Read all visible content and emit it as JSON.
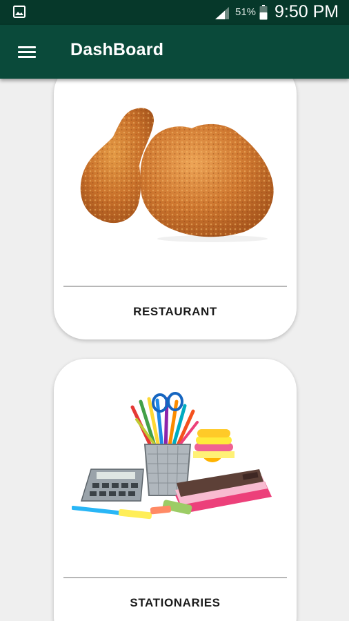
{
  "status_bar": {
    "battery": "51%",
    "time": "9:50 PM",
    "icons": [
      "gallery-icon",
      "signal-icon",
      "battery-icon"
    ]
  },
  "app_bar": {
    "title": "DashBoard",
    "menu_icon": "hamburger-menu-icon",
    "color": "#0a4a3a"
  },
  "cards": [
    {
      "label": "RESTAURANT",
      "image": "fried-chicken-image"
    },
    {
      "label": "STATIONARIES",
      "image": "stationery-supplies-image"
    }
  ],
  "colors": {
    "status_bar": "#06382a",
    "app_bar": "#0a4a3a",
    "background": "#efefef",
    "card": "#ffffff"
  }
}
